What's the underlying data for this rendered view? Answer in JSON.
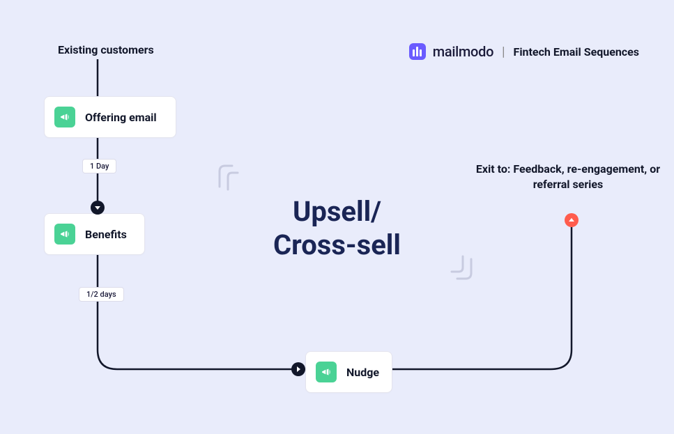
{
  "brand": {
    "name": "mailmodo"
  },
  "header": {
    "subtitle": "Fintech Email Sequences"
  },
  "flow": {
    "start_label": "Existing customers",
    "title_line1": "Upsell/",
    "title_line2": "Cross-sell",
    "exit_text": "Exit to: Feedback, re-engagement, or referral series",
    "nodes": {
      "offering": {
        "label": "Offering email"
      },
      "benefits": {
        "label": "Benefits"
      },
      "nudge": {
        "label": "Nudge"
      }
    },
    "delays": {
      "d1": "1 Day",
      "d2": "1/2 days"
    }
  }
}
